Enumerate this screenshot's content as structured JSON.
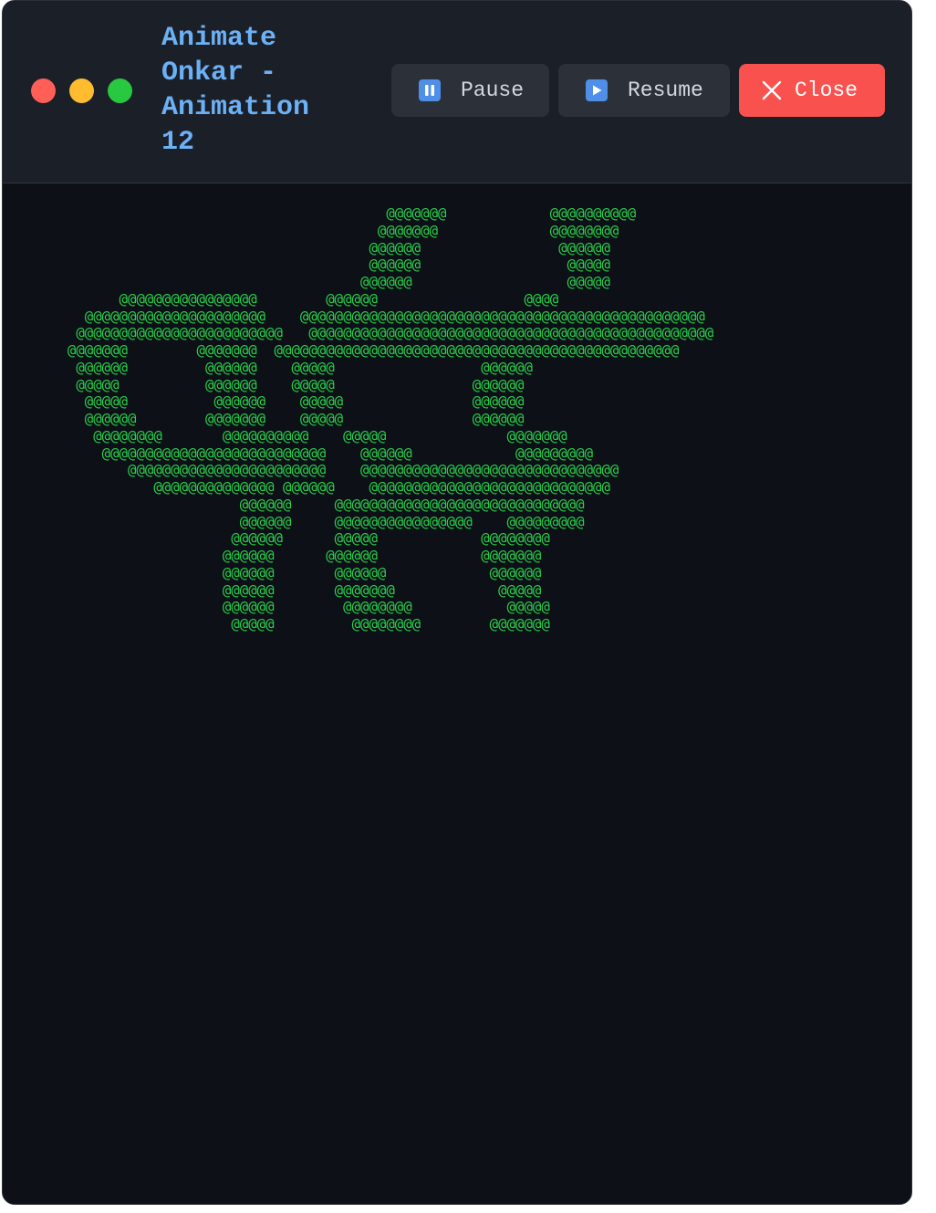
{
  "window": {
    "title": "Animate\nOnkar -\nAnimation\n12"
  },
  "toolbar": {
    "pause_label": "Pause",
    "resume_label": "Resume",
    "close_label": "Close"
  },
  "icons": {
    "pause": "pause-icon",
    "resume": "play-icon",
    "close": "close-icon"
  },
  "colors": {
    "title": "#6cb0f5",
    "ascii": "#29d14a",
    "close_button": "#f9524e",
    "light_red": "#ff5f57",
    "light_yellow": "#febc2e",
    "light_green": "#28c840"
  },
  "canvas": {
    "art": "                                       @@@@@@@            @@@@@@@@@@\n                                      @@@@@@@             @@@@@@@@\n                                     @@@@@@                @@@@@@\n                                     @@@@@@                 @@@@@\n                                    @@@@@@                  @@@@@\n        @@@@@@@@@@@@@@@@        @@@@@@                 @@@@\n    @@@@@@@@@@@@@@@@@@@@@    @@@@@@@@@@@@@@@@@@@@@@@@@@@@@@@@@@@@@@@@@@@@@@@\n   @@@@@@@@@@@@@@@@@@@@@@@@   @@@@@@@@@@@@@@@@@@@@@@@@@@@@@@@@@@@@@@@@@@@@@@@\n  @@@@@@@        @@@@@@@  @@@@@@@@@@@@@@@@@@@@@@@@@@@@@@@@@@@@@@@@@@@@@@@\n   @@@@@@         @@@@@@    @@@@@                 @@@@@@\n   @@@@@          @@@@@@    @@@@@                @@@@@@\n    @@@@@          @@@@@@    @@@@@               @@@@@@\n    @@@@@@        @@@@@@@    @@@@@               @@@@@@\n     @@@@@@@@       @@@@@@@@@@    @@@@@              @@@@@@@\n      @@@@@@@@@@@@@@@@@@@@@@@@@@    @@@@@@            @@@@@@@@@\n         @@@@@@@@@@@@@@@@@@@@@@@    @@@@@@@@@@@@@@@@@@@@@@@@@@@@@@\n            @@@@@@@@@@@@@@ @@@@@@    @@@@@@@@@@@@@@@@@@@@@@@@@@@@\n                      @@@@@@     @@@@@@@@@@@@@@@@@@@@@@@@@@@@@\n                      @@@@@@     @@@@@@@@@@@@@@@@    @@@@@@@@@\n                     @@@@@@      @@@@@            @@@@@@@@\n                    @@@@@@      @@@@@@            @@@@@@@\n                    @@@@@@       @@@@@@            @@@@@@\n                    @@@@@@       @@@@@@@            @@@@@\n                    @@@@@@        @@@@@@@@           @@@@@\n                     @@@@@         @@@@@@@@        @@@@@@@"
  }
}
